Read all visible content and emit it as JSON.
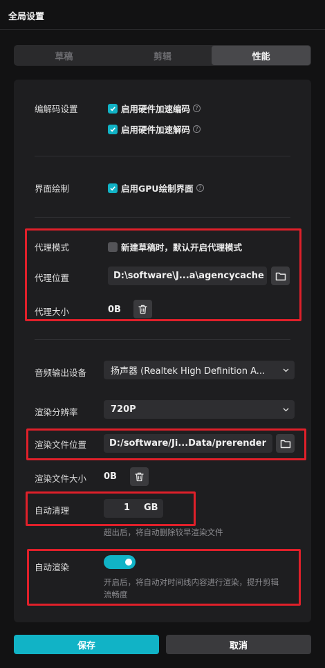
{
  "window": {
    "title": "全局设置"
  },
  "tabs": [
    {
      "label": "草稿",
      "active": false
    },
    {
      "label": "剪辑",
      "active": false
    },
    {
      "label": "性能",
      "active": true
    }
  ],
  "codec": {
    "label": "编解码设置",
    "hw_encode": {
      "label": "启用硬件加速编码",
      "checked": true
    },
    "hw_decode": {
      "label": "启用硬件加速解码",
      "checked": true
    }
  },
  "ui_render": {
    "label": "界面绘制",
    "gpu": {
      "label": "启用GPU绘制界面",
      "checked": true
    }
  },
  "proxy": {
    "mode_label": "代理模式",
    "mode_checkbox": {
      "label": "新建草稿时，默认开启代理模式",
      "checked": false
    },
    "location_label": "代理位置",
    "location_value": "D:\\software\\J...a\\agencycache",
    "size_label": "代理大小",
    "size_value": "0B"
  },
  "audio": {
    "label": "音频输出设备",
    "value": "扬声器 (Realtek High Definition A..."
  },
  "render": {
    "resolution_label": "渲染分辨率",
    "resolution_value": "720P",
    "file_location_label": "渲染文件位置",
    "file_location_value": "D:/software/Ji...Data/prerender",
    "file_size_label": "渲染文件大小",
    "file_size_value": "0B",
    "auto_clean_label": "自动清理",
    "auto_clean_value": "1",
    "auto_clean_unit": "GB",
    "auto_clean_hint": "超出后，将自动删除较早渲染文件",
    "auto_render_label": "自动渲染",
    "auto_render_on": true,
    "auto_render_hint_line1": "开启后，将自动对时间线内容进行渲染，提升剪辑",
    "auto_render_hint_line2": "流畅度"
  },
  "buttons": {
    "save": "保存",
    "cancel": "取消"
  },
  "colors": {
    "accent": "#11b3c6",
    "highlight_box": "#e0202a",
    "background": "#121213",
    "panel": "#1e1e20"
  },
  "icons": [
    "help-icon",
    "folder-icon",
    "trash-icon",
    "chevron-down-icon",
    "checkmark-icon"
  ]
}
